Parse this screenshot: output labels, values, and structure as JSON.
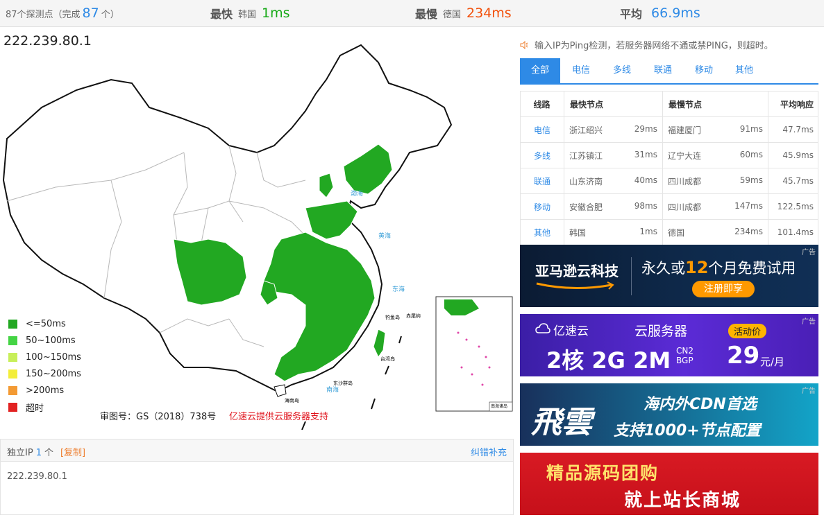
{
  "topbar": {
    "probe_count": "87个探测点（完成",
    "probe_done": "87",
    "probe_unit": "个）",
    "fastest_label": "最快",
    "fastest_loc": "韩国",
    "fastest_value": "1ms",
    "slowest_label": "最慢",
    "slowest_loc": "德国",
    "slowest_value": "234ms",
    "avg_label": "平均",
    "avg_value": "66.9ms"
  },
  "target_ip": "222.239.80.1",
  "legend": [
    {
      "label": "<=50ms",
      "color": "#22a822"
    },
    {
      "label": "50~100ms",
      "color": "#44d444"
    },
    {
      "label": "100~150ms",
      "color": "#c8ef5a"
    },
    {
      "label": "150~200ms",
      "color": "#f3ee3a"
    },
    {
      "label": ">200ms",
      "color": "#f39a33"
    },
    {
      "label": "超时",
      "color": "#e22222"
    }
  ],
  "map_footer": {
    "review_no": "审图号：GS（2018）738号",
    "sponsor": "亿速云提供云服务器支持"
  },
  "ipbox": {
    "label": "独立IP",
    "count": "1",
    "unit": "个",
    "copy": "[复制]",
    "correct": "纠错补充",
    "ip": "222.239.80.1"
  },
  "notice": "输入IP为Ping检测，若服务器网络不通或禁PING，则超时。",
  "tabs": [
    "全部",
    "电信",
    "多线",
    "联通",
    "移动",
    "其他"
  ],
  "table": {
    "headers": [
      "线路",
      "最快节点",
      "最慢节点",
      "平均响应"
    ],
    "rows": [
      {
        "line": "电信",
        "fast": "浙江绍兴",
        "fast_ms": "29ms",
        "slow": "福建厦门",
        "slow_ms": "91ms",
        "avg": "47.7ms"
      },
      {
        "line": "多线",
        "fast": "江苏镇江",
        "fast_ms": "31ms",
        "slow": "辽宁大连",
        "slow_ms": "60ms",
        "avg": "45.9ms"
      },
      {
        "line": "联通",
        "fast": "山东济南",
        "fast_ms": "40ms",
        "slow": "四川成都",
        "slow_ms": "59ms",
        "avg": "45.7ms"
      },
      {
        "line": "移动",
        "fast": "安徽合肥",
        "fast_ms": "98ms",
        "slow": "四川成都",
        "slow_ms": "147ms",
        "avg": "122.5ms"
      },
      {
        "line": "其他",
        "fast": "韩国",
        "fast_ms": "1ms",
        "slow": "德国",
        "slow_ms": "234ms",
        "avg": "101.4ms"
      }
    ]
  },
  "ads": {
    "tag": "广告",
    "ad1": {
      "brand": "亚马逊云科技",
      "text_a": "永久或",
      "text_num": "12",
      "text_b": "个月免费试用",
      "button": "注册即享"
    },
    "ad2": {
      "brand": "亿速云",
      "title": "云服务器",
      "badge": "活动价",
      "spec": "2核 2G 2M",
      "cn2": "CN2",
      "bgp": "BGP",
      "price": "29",
      "per": "元/月"
    },
    "ad3": {
      "brand": "飛雲",
      "line1": "海内外CDN首选",
      "line2": "支持1000+节点配置"
    },
    "ad4": {
      "line1": "精品源码团购",
      "line2": "就上站长商城"
    }
  }
}
